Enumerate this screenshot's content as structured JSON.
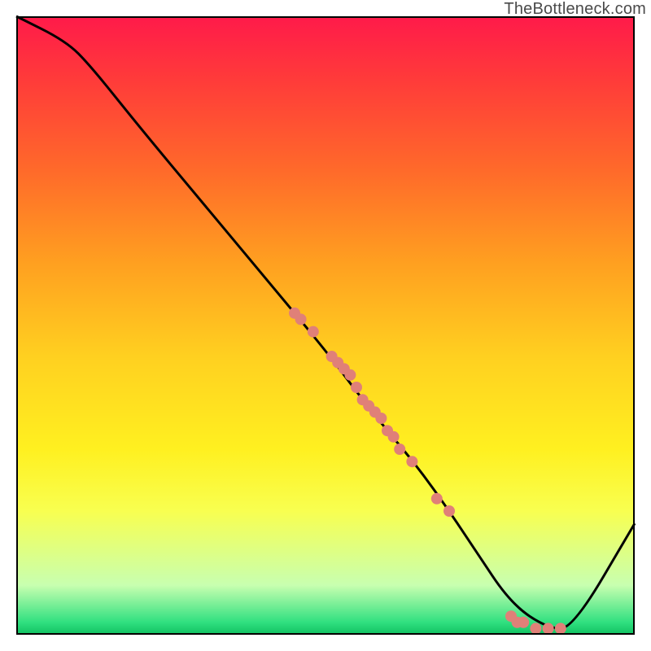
{
  "watermark": "TheBottleneck.com",
  "colors": {
    "curve_stroke": "#000000",
    "marker_fill": "#e08078",
    "gradient_top": "#ff1a4a",
    "gradient_mid": "#fff020",
    "gradient_bottom": "#10c060",
    "border": "#000000"
  },
  "chart_data": {
    "type": "line",
    "title": "",
    "xlabel": "",
    "ylabel": "",
    "xlim": [
      0,
      100
    ],
    "ylim": [
      0,
      100
    ],
    "grid": false,
    "legend": false,
    "annotations": [
      "TheBottleneck.com"
    ],
    "series": [
      {
        "name": "curve",
        "x": [
          0,
          8,
          12,
          20,
          30,
          40,
          50,
          56,
          60,
          65,
          70,
          74,
          80,
          86,
          90,
          100
        ],
        "y": [
          100,
          96,
          92,
          82,
          70,
          58,
          46,
          38,
          33,
          27,
          20,
          14,
          5,
          1,
          1,
          18
        ]
      },
      {
        "name": "markers-on-curve",
        "x": [
          45,
          46,
          48,
          51,
          52,
          53,
          54,
          55,
          56,
          57,
          58,
          59,
          60,
          61,
          62,
          64,
          68,
          70,
          80,
          81,
          82,
          84,
          86,
          88
        ],
        "y": [
          52,
          51,
          49,
          45,
          44,
          43,
          42,
          40,
          38,
          37,
          36,
          35,
          33,
          32,
          30,
          28,
          22,
          20,
          3,
          2,
          2,
          1,
          1,
          1
        ]
      }
    ]
  }
}
